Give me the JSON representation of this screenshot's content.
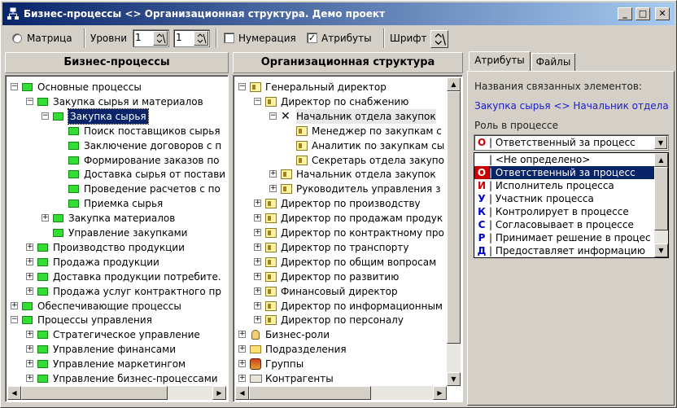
{
  "window": {
    "title": "Бизнес-процессы <> Организационная структура. Демо проект",
    "controls": [
      "_",
      "□",
      "✕"
    ]
  },
  "toolbar": {
    "matrix_label": "Матрица",
    "levels_label": "Уровни",
    "level1_value": "1",
    "level2_value": "1",
    "numbering_label": "Нумерация",
    "numbering_checked": false,
    "attributes_label": "Атрибуты",
    "attributes_checked": true,
    "font_label": "Шрифт"
  },
  "left_panel": {
    "header": "Бизнес-процессы",
    "rows": [
      {
        "text": "Основные процессы",
        "level": 0,
        "exp": "-"
      },
      {
        "text": "Закупка сырья и материалов",
        "level": 1,
        "exp": "-"
      },
      {
        "text": "Закупка сырья",
        "level": 2,
        "exp": "-",
        "selected": true
      },
      {
        "text": "Поиск поставщиков сырья",
        "level": 3,
        "exp": ""
      },
      {
        "text": "Заключение договоров с п",
        "level": 3,
        "exp": ""
      },
      {
        "text": "Формирование заказов по",
        "level": 3,
        "exp": ""
      },
      {
        "text": "Доставка сырья от постави",
        "level": 3,
        "exp": ""
      },
      {
        "text": "Проведение расчетов с по",
        "level": 3,
        "exp": ""
      },
      {
        "text": "Приемка сырья",
        "level": 3,
        "exp": ""
      },
      {
        "text": "Закупка материалов",
        "level": 2,
        "exp": "+"
      },
      {
        "text": "Управление закупками",
        "level": 2,
        "exp": ""
      },
      {
        "text": "Производство продукции",
        "level": 1,
        "exp": "+"
      },
      {
        "text": "Продажа продукции",
        "level": 1,
        "exp": "+"
      },
      {
        "text": "Доставка продукции потребите.",
        "level": 1,
        "exp": "+"
      },
      {
        "text": "Продажа услуг контрактного пр",
        "level": 1,
        "exp": "+"
      },
      {
        "text": "Обеспечивающие процессы",
        "level": 0,
        "exp": "+"
      },
      {
        "text": "Процессы управления",
        "level": 0,
        "exp": "-"
      },
      {
        "text": "Стратегическое управление",
        "level": 1,
        "exp": "+"
      },
      {
        "text": "Управление финансами",
        "level": 1,
        "exp": "+"
      },
      {
        "text": "Управление маркетингом",
        "level": 1,
        "exp": "+"
      },
      {
        "text": "Управление бизнес-процессами",
        "level": 1,
        "exp": "+"
      }
    ]
  },
  "middle_panel": {
    "header": "Организационная структура",
    "rows": [
      {
        "text": "Генеральный директор",
        "level": 0,
        "exp": "-",
        "icon": "org"
      },
      {
        "text": "Директор по снабжению",
        "level": 1,
        "exp": "-",
        "icon": "org"
      },
      {
        "text": "Начальник отдела закупок",
        "level": 2,
        "exp": "-",
        "icon": "x",
        "hl": true
      },
      {
        "text": "Менеджер по закупкам с",
        "level": 3,
        "exp": "",
        "icon": "org"
      },
      {
        "text": "Аналитик по закупкам сы",
        "level": 3,
        "exp": "",
        "icon": "org"
      },
      {
        "text": "Секретарь отдела закупо",
        "level": 3,
        "exp": "",
        "icon": "org"
      },
      {
        "text": "Начальник отдела закупок",
        "level": 2,
        "exp": "+",
        "icon": "org"
      },
      {
        "text": "Руководитель управления з",
        "level": 2,
        "exp": "+",
        "icon": "org"
      },
      {
        "text": "Директор по производству",
        "level": 1,
        "exp": "+",
        "icon": "org"
      },
      {
        "text": "Директор по продажам продук",
        "level": 1,
        "exp": "+",
        "icon": "org"
      },
      {
        "text": "Директор по контрактному про",
        "level": 1,
        "exp": "+",
        "icon": "org"
      },
      {
        "text": "Директор по транспорту",
        "level": 1,
        "exp": "+",
        "icon": "org"
      },
      {
        "text": "Директор по общим вопросам",
        "level": 1,
        "exp": "+",
        "icon": "org"
      },
      {
        "text": "Директор по развитию",
        "level": 1,
        "exp": "+",
        "icon": "org"
      },
      {
        "text": "Финансовый директор",
        "level": 1,
        "exp": "+",
        "icon": "org"
      },
      {
        "text": "Директор по информационным",
        "level": 1,
        "exp": "+",
        "icon": "org"
      },
      {
        "text": "Директор по персоналу",
        "level": 1,
        "exp": "+",
        "icon": "org"
      },
      {
        "text": "Бизнес-роли",
        "level": 0,
        "exp": "+",
        "icon": "person"
      },
      {
        "text": "Подразделения",
        "level": 0,
        "exp": "+",
        "icon": "folder"
      },
      {
        "text": "Группы",
        "level": 0,
        "exp": "+",
        "icon": "group"
      },
      {
        "text": "Контрагенты",
        "level": 0,
        "exp": "+",
        "icon": "card"
      }
    ]
  },
  "right_panel": {
    "tabs": [
      "Атрибуты",
      "Файлы"
    ],
    "linked_label": "Названия связанных элементов:",
    "linked_value": "Закупка сырья <> Начальник отдела",
    "role_label": "Роль в процессе",
    "role_selected_code": "О",
    "role_selected_text": "| Ответственный за процесс",
    "role_options": [
      {
        "code": "",
        "text": "| <Не определено>",
        "color": "#000000"
      },
      {
        "code": "О",
        "text": "| Ответственный за процесс",
        "color": "#cc0000",
        "hl": true
      },
      {
        "code": "И",
        "text": "| Исполнитель процесса",
        "color": "#cc0000"
      },
      {
        "code": "У",
        "text": "| Участник процесса",
        "color": "#0000cc"
      },
      {
        "code": "К",
        "text": "| Контролирует в процессе",
        "color": "#0000cc"
      },
      {
        "code": "С",
        "text": "| Согласовывает в процессе",
        "color": "#0000cc"
      },
      {
        "code": "Р",
        "text": "| Принимает решение в процес",
        "color": "#0000cc"
      },
      {
        "code": "Д",
        "text": "| Предоставляет информацию",
        "color": "#0000cc"
      }
    ]
  }
}
